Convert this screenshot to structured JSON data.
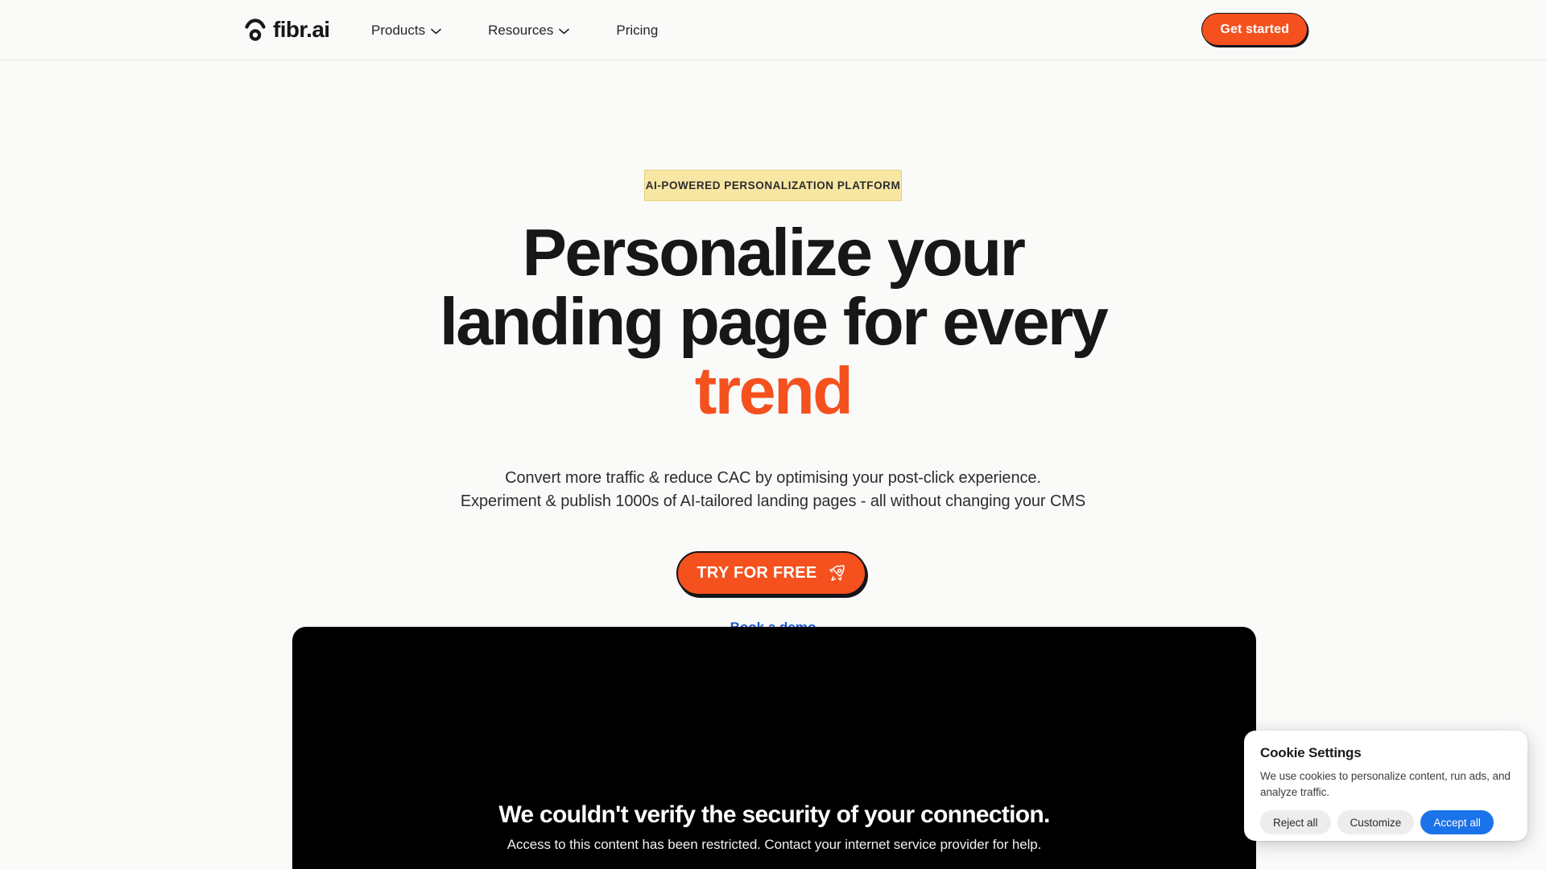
{
  "brand": {
    "name": "fibr.ai",
    "accent_color": "#F4511E",
    "link_color": "#1A56DB"
  },
  "header": {
    "logo_label": "fibr.ai",
    "nav": [
      {
        "label": "Products",
        "has_dropdown": true
      },
      {
        "label": "Resources",
        "has_dropdown": true
      },
      {
        "label": "Pricing",
        "has_dropdown": false
      }
    ],
    "cta_label": "Get started"
  },
  "hero": {
    "badge": "AI-POWERED PERSONALIZATION PLATFORM",
    "badge_bg": "#F8E7A2",
    "headline_line1": "Personalize your",
    "headline_line2": "landing page for every",
    "headline_accent": "trend",
    "subtitle_line1": "Convert more traffic & reduce CAC by optimising your post-click experience.",
    "subtitle_line2": "Experiment & publish 1000s of AI-tailored landing pages - all without changing your CMS",
    "primary_cta": "TRY FOR FREE",
    "secondary_cta": "Book a demo"
  },
  "panel": {
    "title": "We couldn't verify the security of your connection.",
    "subtitle": "Access to this content has been restricted. Contact your internet service provider for help.",
    "background": "#000000"
  },
  "cookie": {
    "title": "Cookie Settings",
    "body": "We use cookies to personalize content, run ads, and analyze traffic.",
    "reject_label": "Reject all",
    "customize_label": "Customize",
    "accept_label": "Accept all",
    "accept_color": "#1A73E8"
  }
}
